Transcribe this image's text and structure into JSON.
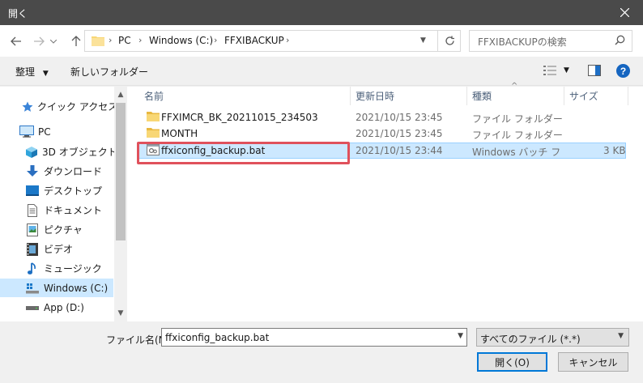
{
  "window": {
    "title": "開く"
  },
  "address": {
    "crumbs": [
      "PC",
      "Windows (C:)",
      "FFXIBACKUP"
    ]
  },
  "search": {
    "placeholder": "FFXIBACKUPの検索"
  },
  "toolbar": {
    "organize": "整理",
    "new_folder": "新しいフォルダー"
  },
  "sidebar": {
    "items": [
      {
        "label": "クイック アクセス",
        "icon": "star-icon"
      },
      {
        "label": "PC",
        "icon": "computer-icon"
      },
      {
        "label": "3D オブジェクト",
        "icon": "cube-icon"
      },
      {
        "label": "ダウンロード",
        "icon": "download-icon"
      },
      {
        "label": "デスクトップ",
        "icon": "desktop-icon"
      },
      {
        "label": "ドキュメント",
        "icon": "document-icon"
      },
      {
        "label": "ピクチャ",
        "icon": "picture-icon"
      },
      {
        "label": "ビデオ",
        "icon": "video-icon"
      },
      {
        "label": "ミュージック",
        "icon": "music-icon"
      },
      {
        "label": "Windows (C:)",
        "icon": "drive-icon",
        "selected": true
      },
      {
        "label": "App (D:)",
        "icon": "drive-icon"
      }
    ]
  },
  "columns": {
    "name": "名前",
    "date": "更新日時",
    "type": "種類",
    "size": "サイズ"
  },
  "files": [
    {
      "name": "FFXIMCR_BK_20211015_234503",
      "date": "2021/10/15 23:45",
      "type": "ファイル フォルダー",
      "size": ""
    },
    {
      "name": "MONTH",
      "date": "2021/10/15 23:45",
      "type": "ファイル フォルダー",
      "size": ""
    },
    {
      "name": "ffxiconfig_backup.bat",
      "date": "2021/10/15 23:44",
      "type": "Windows バッチ ファ...",
      "size": "3 KB"
    }
  ],
  "bottom": {
    "filename_label": "ファイル名(N):",
    "filename_value": "ffxiconfig_backup.bat",
    "filetype": "すべてのファイル (*.*)",
    "open": "開く(O)",
    "cancel": "キャンセル"
  },
  "colors": {
    "selection": "#cce8ff",
    "highlight": "#e0515c",
    "titlebar": "#4a4a4a"
  }
}
